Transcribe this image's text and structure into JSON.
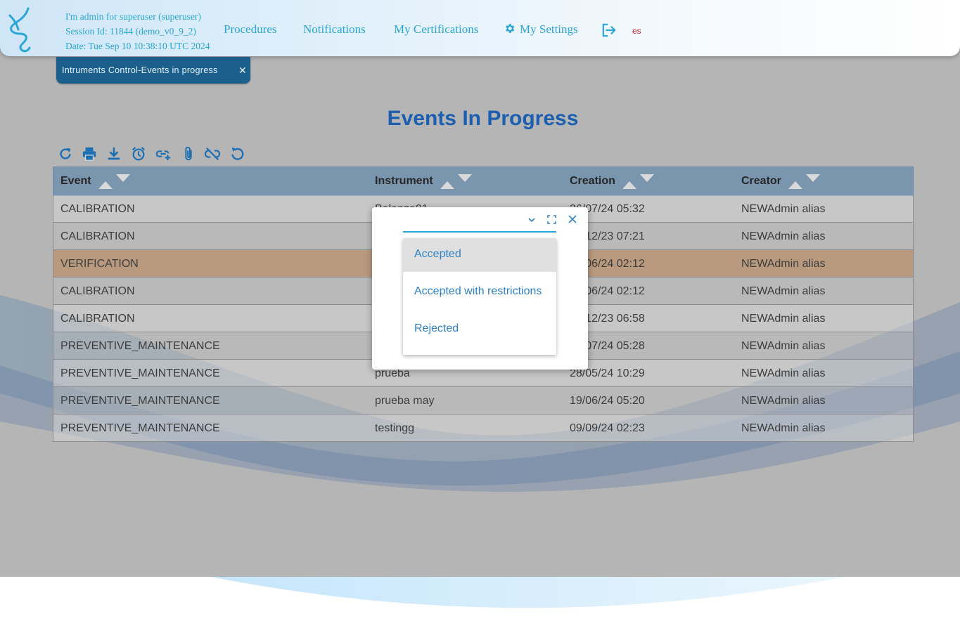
{
  "header": {
    "session_user": "I'm admin for superuser (superuser)",
    "session_id": "Session Id: 11844 (demo_v0_9_2)",
    "session_date": "Date: Tue Sep 10 10:38:10 UTC 2024",
    "nav": {
      "procedures": "Procedures",
      "notifications": "Notifications",
      "certifications": "My Certifications",
      "settings": "My Settings"
    },
    "language": "es"
  },
  "tab": {
    "label": "Intruments Control-Events in progress"
  },
  "page": {
    "title": "Events In Progress"
  },
  "toolbar": {
    "icons": [
      "refresh-icon",
      "print-icon",
      "download-icon",
      "alarm-icon",
      "link-add-icon",
      "attachment-icon",
      "link-off-icon",
      "undo-icon"
    ]
  },
  "table": {
    "headers": {
      "event": "Event",
      "instrument": "Instrument",
      "creation": "Creation",
      "creator": "Creator"
    },
    "rows": [
      {
        "event": "CALIBRATION",
        "instrument": "Balanza01",
        "creation": "26/07/24 05:32",
        "creator": "NEWAdmin alias"
      },
      {
        "event": "CALIBRATION",
        "instrument": "",
        "creation": "12/12/23 07:21",
        "creator": "NEWAdmin alias"
      },
      {
        "event": "VERIFICATION",
        "instrument": "",
        "creation": "10/06/24 02:12",
        "creator": "NEWAdmin alias"
      },
      {
        "event": "CALIBRATION",
        "instrument": "",
        "creation": "10/06/24 02:12",
        "creator": "NEWAdmin alias"
      },
      {
        "event": "CALIBRATION",
        "instrument": "",
        "creation": "12/12/23 06:58",
        "creator": "NEWAdmin alias"
      },
      {
        "event": "PREVENTIVE_MAINTENANCE",
        "instrument": "",
        "creation": "26/07/24 05:28",
        "creator": "NEWAdmin alias"
      },
      {
        "event": "PREVENTIVE_MAINTENANCE",
        "instrument": "prueba",
        "creation": "28/05/24 10:29",
        "creator": "NEWAdmin alias"
      },
      {
        "event": "PREVENTIVE_MAINTENANCE",
        "instrument": "prueba may",
        "creation": "19/06/24 05:20",
        "creator": "NEWAdmin alias"
      },
      {
        "event": "PREVENTIVE_MAINTENANCE",
        "instrument": "testingg",
        "creation": "09/09/24 02:23",
        "creator": "NEWAdmin alias"
      }
    ]
  },
  "modal": {
    "selected_value": "",
    "options": [
      "Accepted",
      "Accepted with restrictions",
      "Rejected"
    ],
    "highlighted_option": "Accepted"
  },
  "colors": {
    "accent": "#2aa6d6",
    "title": "#1c5fb0",
    "tab": "#1b5f8c",
    "highlight_row": "#b99a7e",
    "language": "#d22a2a"
  }
}
